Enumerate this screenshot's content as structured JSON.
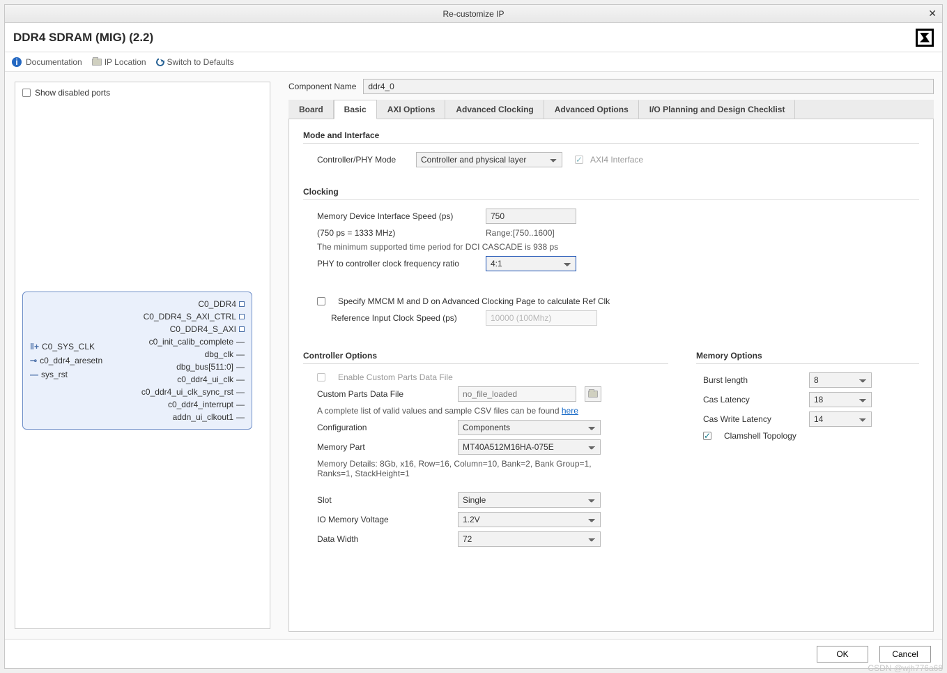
{
  "dialog": {
    "title": "Re-customize IP"
  },
  "header": {
    "title": "DDR4 SDRAM (MIG) (2.2)"
  },
  "links": {
    "doc": "Documentation",
    "loc": "IP Location",
    "reset": "Switch to Defaults"
  },
  "left": {
    "show_disabled": "Show disabled ports",
    "inports": [
      "C0_SYS_CLK",
      "c0_ddr4_aresetn",
      "sys_rst"
    ],
    "outports": [
      "C0_DDR4",
      "C0_DDR4_S_AXI_CTRL",
      "C0_DDR4_S_AXI",
      "c0_init_calib_complete",
      "dbg_clk",
      "dbg_bus[511:0]",
      "c0_ddr4_ui_clk",
      "c0_ddr4_ui_clk_sync_rst",
      "c0_ddr4_interrupt",
      "addn_ui_clkout1"
    ]
  },
  "component": {
    "label": "Component Name",
    "value": "ddr4_0"
  },
  "tabs": [
    "Board",
    "Basic",
    "AXI Options",
    "Advanced Clocking",
    "Advanced Options",
    "I/O Planning and Design Checklist"
  ],
  "active_tab": 1,
  "mode": {
    "title": "Mode and Interface",
    "ctrl_label": "Controller/PHY Mode",
    "ctrl_value": "Controller and physical layer",
    "axi4_label": "AXI4 Interface"
  },
  "clocking": {
    "title": "Clocking",
    "speed_label": "Memory Device Interface Speed (ps)",
    "speed_value": "750",
    "speed_sub1": "(750 ps = 1333 MHz)",
    "speed_range": "Range:[750..1600]",
    "speed_note": "The minimum supported time period for DCI CASCADE is 938 ps",
    "ratio_label": "PHY to controller clock frequency ratio",
    "ratio_value": "4:1",
    "mmcm_label": "Specify MMCM M and D on Advanced Clocking Page to calculate Ref Clk",
    "ref_label": "Reference Input Clock Speed (ps)",
    "ref_value": "10000 (100Mhz)"
  },
  "controller": {
    "title": "Controller Options",
    "enable_custom": "Enable Custom Parts Data File",
    "custom_file_label": "Custom Parts Data File",
    "custom_file_placeholder": "no_file_loaded",
    "valid_note": "A complete list of valid values and sample CSV files can be found ",
    "here": "here",
    "config_label": "Configuration",
    "config_value": "Components",
    "part_label": "Memory Part",
    "part_value": "MT40A512M16HA-075E",
    "details": "Memory Details: 8Gb, x16, Row=16, Column=10, Bank=2, Bank Group=1, Ranks=1, StackHeight=1",
    "slot_label": "Slot",
    "slot_value": "Single",
    "iov_label": "IO Memory Voltage",
    "iov_value": "1.2V",
    "dw_label": "Data Width",
    "dw_value": "72"
  },
  "memopts": {
    "title": "Memory Options",
    "burst_label": "Burst length",
    "burst_value": "8",
    "cas_label": "Cas Latency",
    "cas_value": "18",
    "cwl_label": "Cas Write Latency",
    "cwl_value": "14",
    "clam_label": "Clamshell Topology"
  },
  "buttons": {
    "ok": "OK",
    "cancel": "Cancel"
  },
  "watermark": "CSDN @wjh776a68"
}
